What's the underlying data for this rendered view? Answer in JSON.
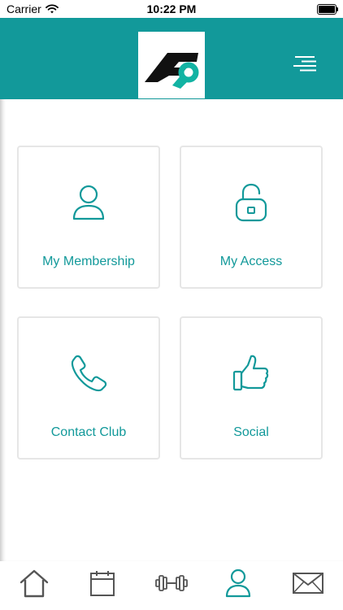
{
  "status_bar": {
    "carrier": "Carrier",
    "time": "10:22 PM",
    "wifi_icon": "wifi-icon",
    "battery_icon": "battery-full-icon"
  },
  "header": {
    "logo_icon": "club-logo",
    "menu_icon": "menu-icon",
    "background_color": "#12999a"
  },
  "tiles": [
    {
      "label": "My Membership",
      "icon": "person-icon"
    },
    {
      "label": "My Access",
      "icon": "unlocked-padlock-icon"
    },
    {
      "label": "Contact Club",
      "icon": "phone-icon"
    },
    {
      "label": "Social",
      "icon": "thumbs-up-icon"
    }
  ],
  "tab_bar": {
    "items": [
      {
        "icon": "home-icon",
        "active": false
      },
      {
        "icon": "calendar-icon",
        "active": false
      },
      {
        "icon": "dumbbell-icon",
        "active": false
      },
      {
        "icon": "person-icon",
        "active": true
      },
      {
        "icon": "mail-icon",
        "active": false
      }
    ],
    "active_color": "#12999a",
    "inactive_color": "#555555"
  }
}
